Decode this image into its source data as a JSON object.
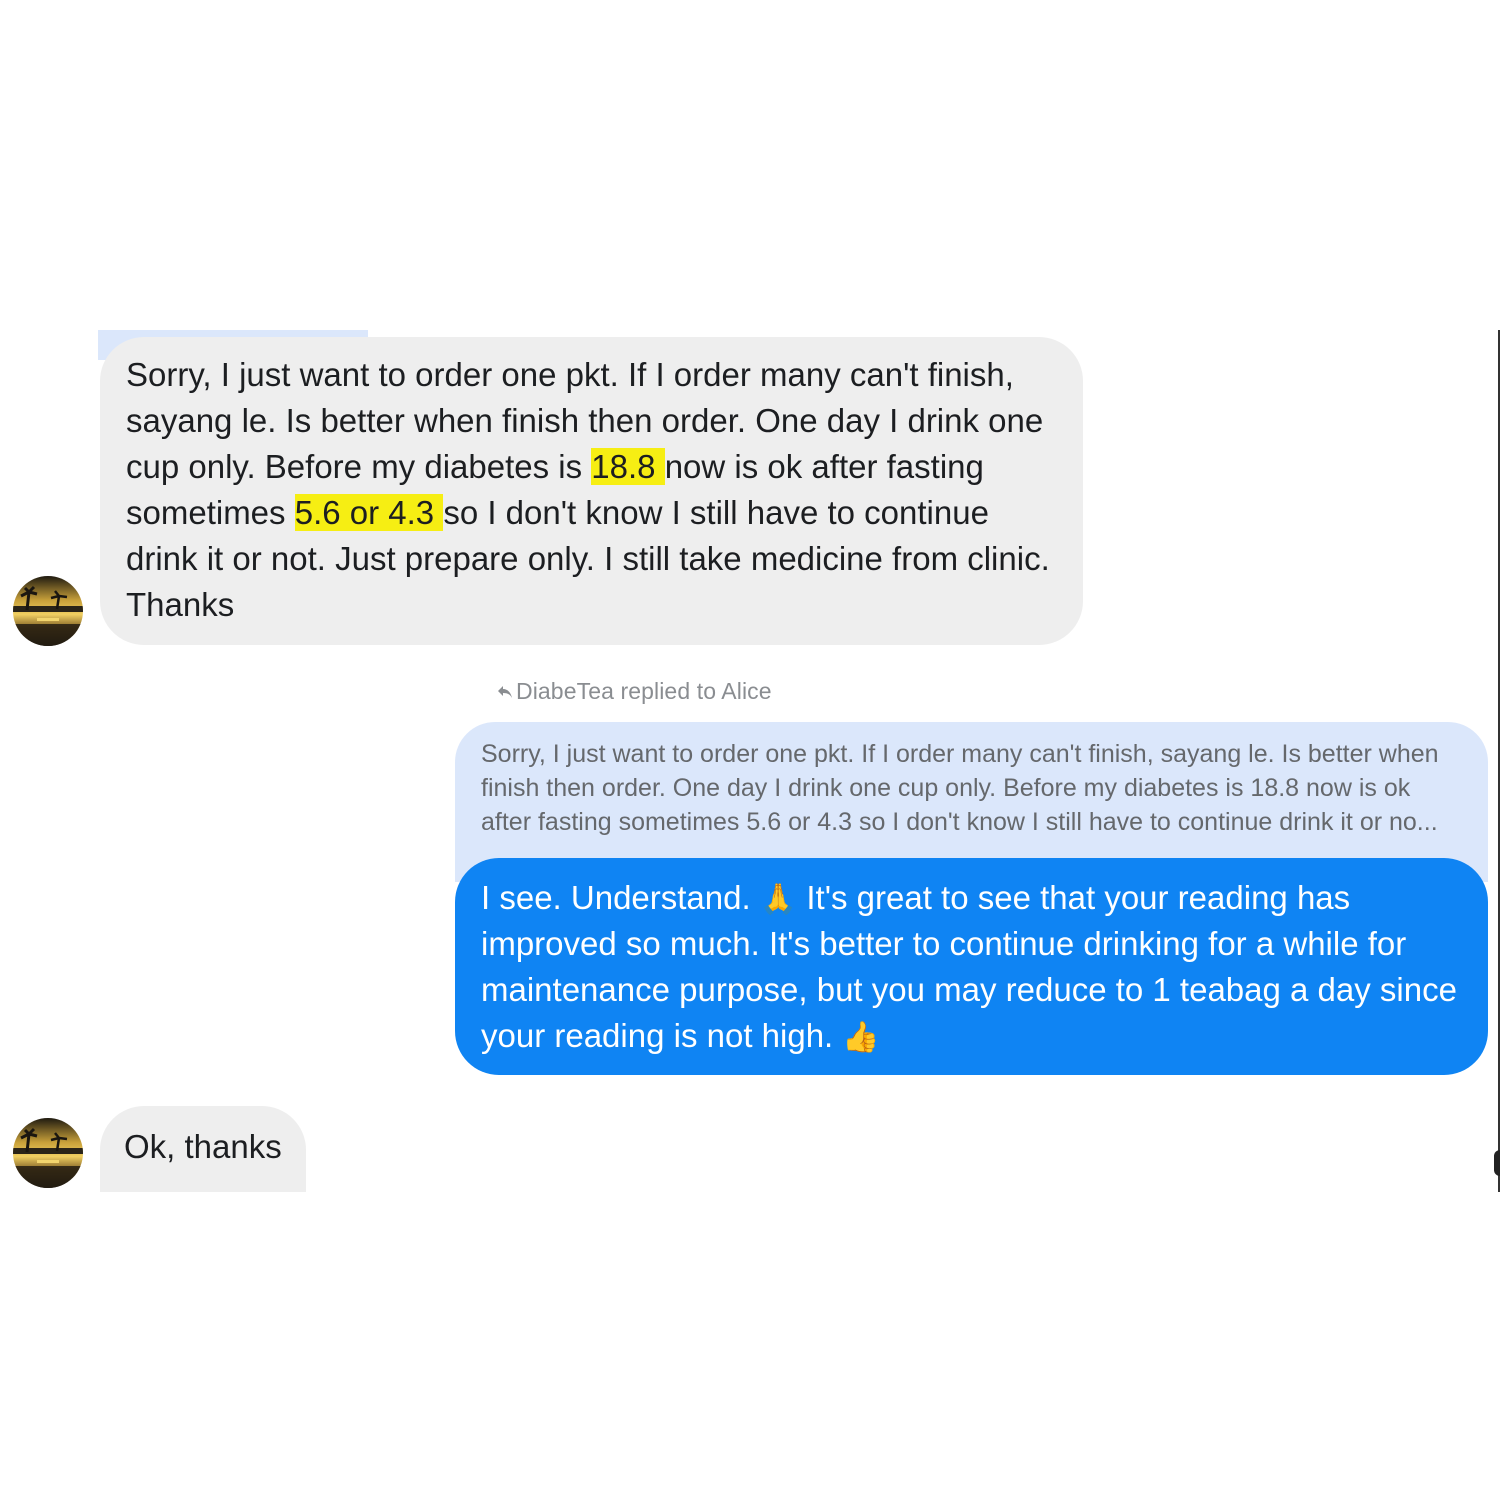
{
  "messages": {
    "incoming_1": {
      "part1": "Sorry, I just want to order one pkt. If I order many can't finish, sayang le. Is better when finish then order. One day I drink one cup only. Before my diabetes is ",
      "highlight1": "18.8 ",
      "part2": "now is ok after fasting sometimes ",
      "highlight2": "5.6 or 4.3 ",
      "part3": "so I don't know I still have to continue drink it or not. Just prepare only. I still take medicine from clinic. Thanks"
    },
    "reply_label": "DiabeTea replied to Alice",
    "quoted_text": "Sorry, I just want to order one pkt. If I order many can't finish, sayang le. Is better when finish then order. One day I drink one cup only. Before my diabetes is 18.8 now is ok after fasting sometimes 5.6 or 4.3 so I don't know I still have to continue drink it or no...",
    "outgoing": {
      "part1": "I see. Understand. ",
      "emoji1": "🙏",
      "part2": " It's great to see that your reading has improved so much. It's better to continue drinking for a while for maintenance purpose, but you may reduce to 1 teabag a day since your reading is not high. ",
      "emoji2": "👍"
    },
    "incoming_2": "Ok, thanks"
  },
  "colors": {
    "incoming_bubble": "#eeeeee",
    "outgoing_bubble": "#0f84f3",
    "quoted_bubble": "#dbe7fb",
    "highlight": "#f6ee13"
  },
  "icons": {
    "avatar": "sunset-palm-avatar",
    "reply": "reply-arrow-icon"
  }
}
